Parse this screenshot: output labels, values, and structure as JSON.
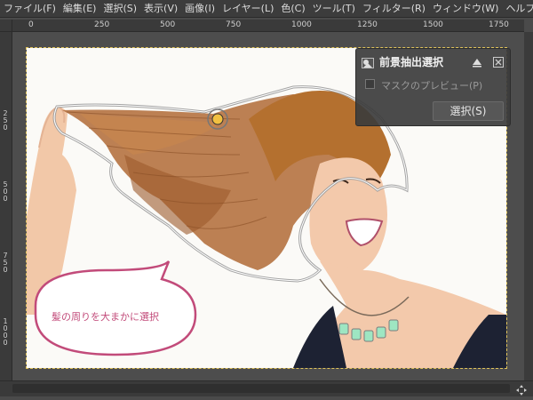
{
  "menu": [
    {
      "label": "ファイル(F)"
    },
    {
      "label": "編集(E)"
    },
    {
      "label": "選択(S)"
    },
    {
      "label": "表示(V)"
    },
    {
      "label": "画像(I)"
    },
    {
      "label": "レイヤー(L)"
    },
    {
      "label": "色(C)"
    },
    {
      "label": "ツール(T)"
    },
    {
      "label": "フィルター(R)"
    },
    {
      "label": "ウィンドウ(W)"
    },
    {
      "label": "ヘルプ(H)"
    }
  ],
  "ruler": {
    "top_labels": [
      "0",
      "250",
      "500",
      "750",
      "1000",
      "1250",
      "1500",
      "1750"
    ],
    "left_labels": [
      "2\n5\n0",
      "5\n0\n0",
      "7\n5\n0",
      "1\n0\n0\n0"
    ]
  },
  "dialog": {
    "title": "前景抽出選択",
    "checkbox_label": "マスクのプレビュー(P)",
    "button_label": "選択(S)"
  },
  "annotation": {
    "text": "髪の周りを大まかに選択"
  },
  "colors": {
    "accent_pink": "#c24b7a",
    "selection_outline": "#9a9a9a"
  }
}
